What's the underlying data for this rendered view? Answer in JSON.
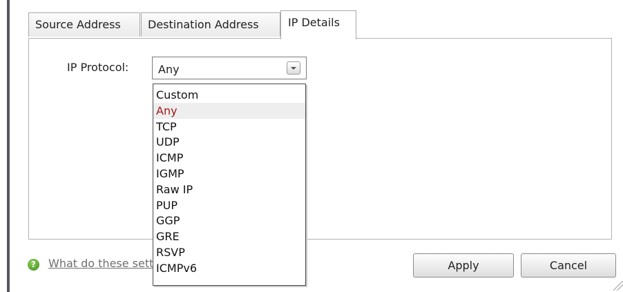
{
  "tabs": [
    {
      "label": "Source Address",
      "active": false
    },
    {
      "label": "Destination Address",
      "active": false
    },
    {
      "label": "IP Details",
      "active": true
    }
  ],
  "form": {
    "ip_protocol_label": "IP Protocol:",
    "ip_protocol_value": "Any"
  },
  "dropdown": {
    "options": [
      "Custom",
      "Any",
      "TCP",
      "UDP",
      "ICMP",
      "IGMP",
      "Raw IP",
      "PUP",
      "GGP",
      "GRE",
      "RSVP",
      "ICMPv6"
    ],
    "highlighted": "Any"
  },
  "footer": {
    "help_link": "What do these settings mean?",
    "apply_label": "Apply",
    "cancel_label": "Cancel"
  },
  "icons": {
    "help": "help-question-icon",
    "dropdown_arrow": "chevron-down-icon",
    "resize": "resize-grip-icon"
  },
  "colors": {
    "selected_option_text": "#a01919",
    "help_icon": "#4f9e2a",
    "left_rule": "#56565e"
  }
}
